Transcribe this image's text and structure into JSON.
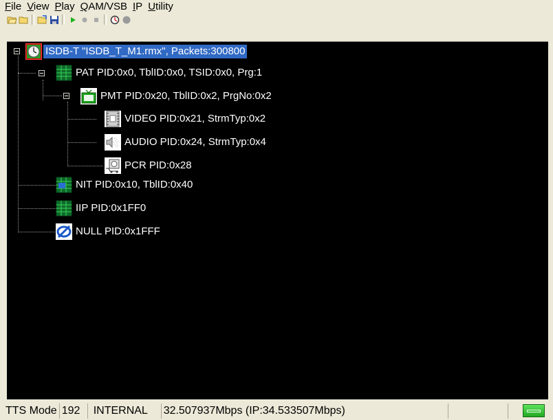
{
  "menu": {
    "items": [
      {
        "first": "F",
        "rest": "ile"
      },
      {
        "first": "V",
        "rest": "iew"
      },
      {
        "first": "P",
        "rest": "lay"
      },
      {
        "first": "Q",
        "rest": "AM/VSB"
      },
      {
        "first": "I",
        "rest": "P"
      },
      {
        "first": "U",
        "rest": "tility"
      }
    ]
  },
  "toolbar": {
    "icons": [
      "open-folder-icon",
      "folder-icon",
      "open-file-icon",
      "save-icon",
      "play-icon",
      "record-icon",
      "stop-icon",
      "timer-icon",
      "status-icon"
    ]
  },
  "tree": {
    "root": "ISDB-T \"ISDB_T_M1.rmx\", Packets:300800",
    "pat": "PAT PID:0x0, TblID:0x0, TSID:0x0, Prg:1",
    "pmt": "PMT PID:0x20, TblID:0x2, PrgNo:0x2",
    "video": "VIDEO PID:0x21, StrmTyp:0x2",
    "audio": "AUDIO PID:0x24, StrmTyp:0x4",
    "pcr": "PCR PID:0x28",
    "nit": "NIT PID:0x10, TblID:0x40",
    "iip": "IIP PID:0x1FF0",
    "null": "NULL PID:0x1FFF"
  },
  "status": {
    "mode": "TTS Mode",
    "packet_size": "192",
    "clock": "INTERNAL",
    "rate": "32.507937Mbps (IP:34.533507Mbps)",
    "led_color": "#22a822"
  }
}
